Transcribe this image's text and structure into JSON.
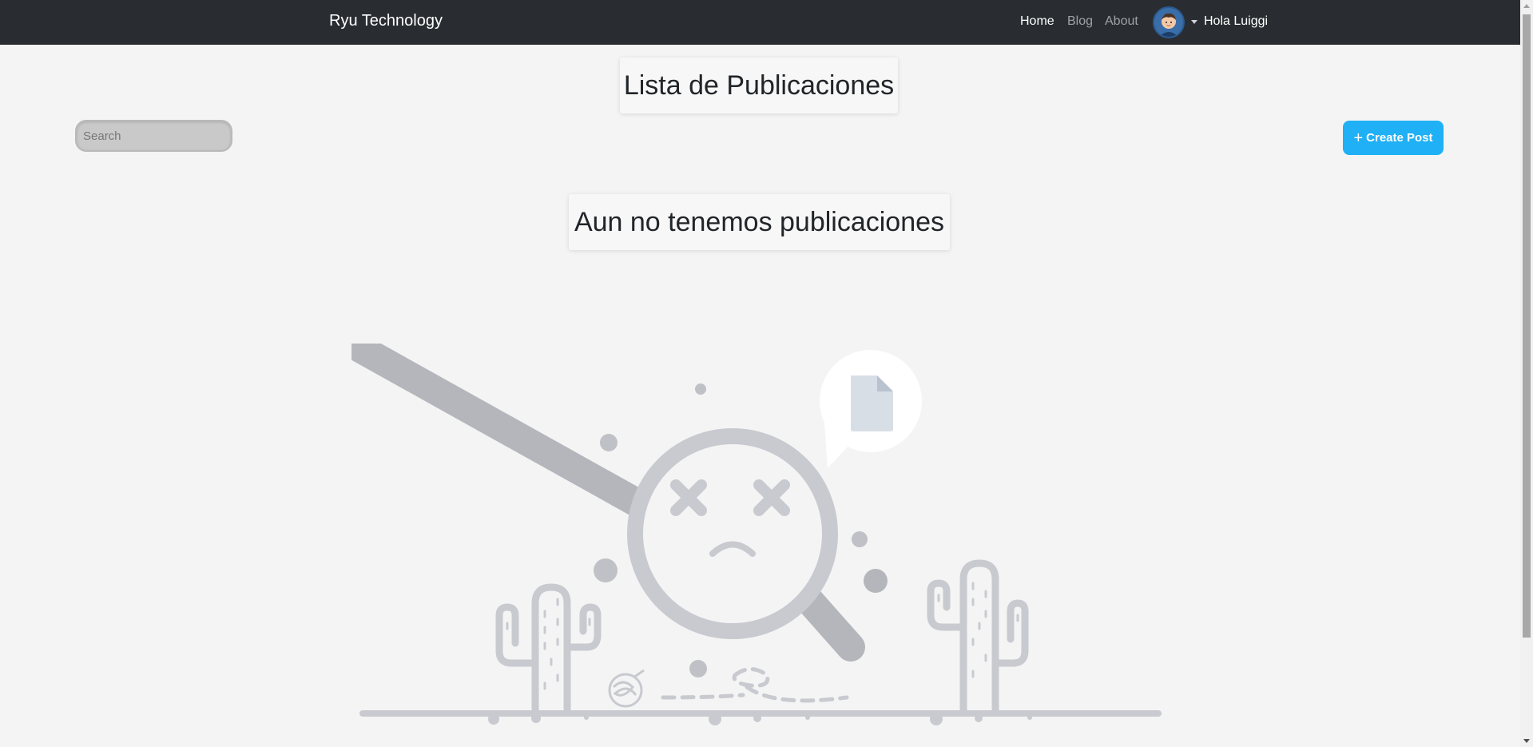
{
  "navbar": {
    "brand": "Ryu Technology",
    "links": [
      {
        "label": "Home",
        "active": true
      },
      {
        "label": "Blog",
        "active": false
      },
      {
        "label": "About",
        "active": false
      }
    ],
    "avatar_icon": "user-avatar-icon",
    "greeting": "Hola Luiggi"
  },
  "main": {
    "title": "Lista de Publicaciones",
    "search_placeholder": "Search",
    "search_value": "",
    "create_button": {
      "icon": "+",
      "label": "Create Post"
    },
    "empty_message": "Aun no tenemos publicaciones",
    "empty_illustration_icon": "not-found-magnifier-icon"
  },
  "colors": {
    "navbar_bg": "#292d31",
    "page_bg": "#f4f4f4",
    "accent": "#1fb0f5",
    "illustration_gray": "#c8cad0"
  }
}
